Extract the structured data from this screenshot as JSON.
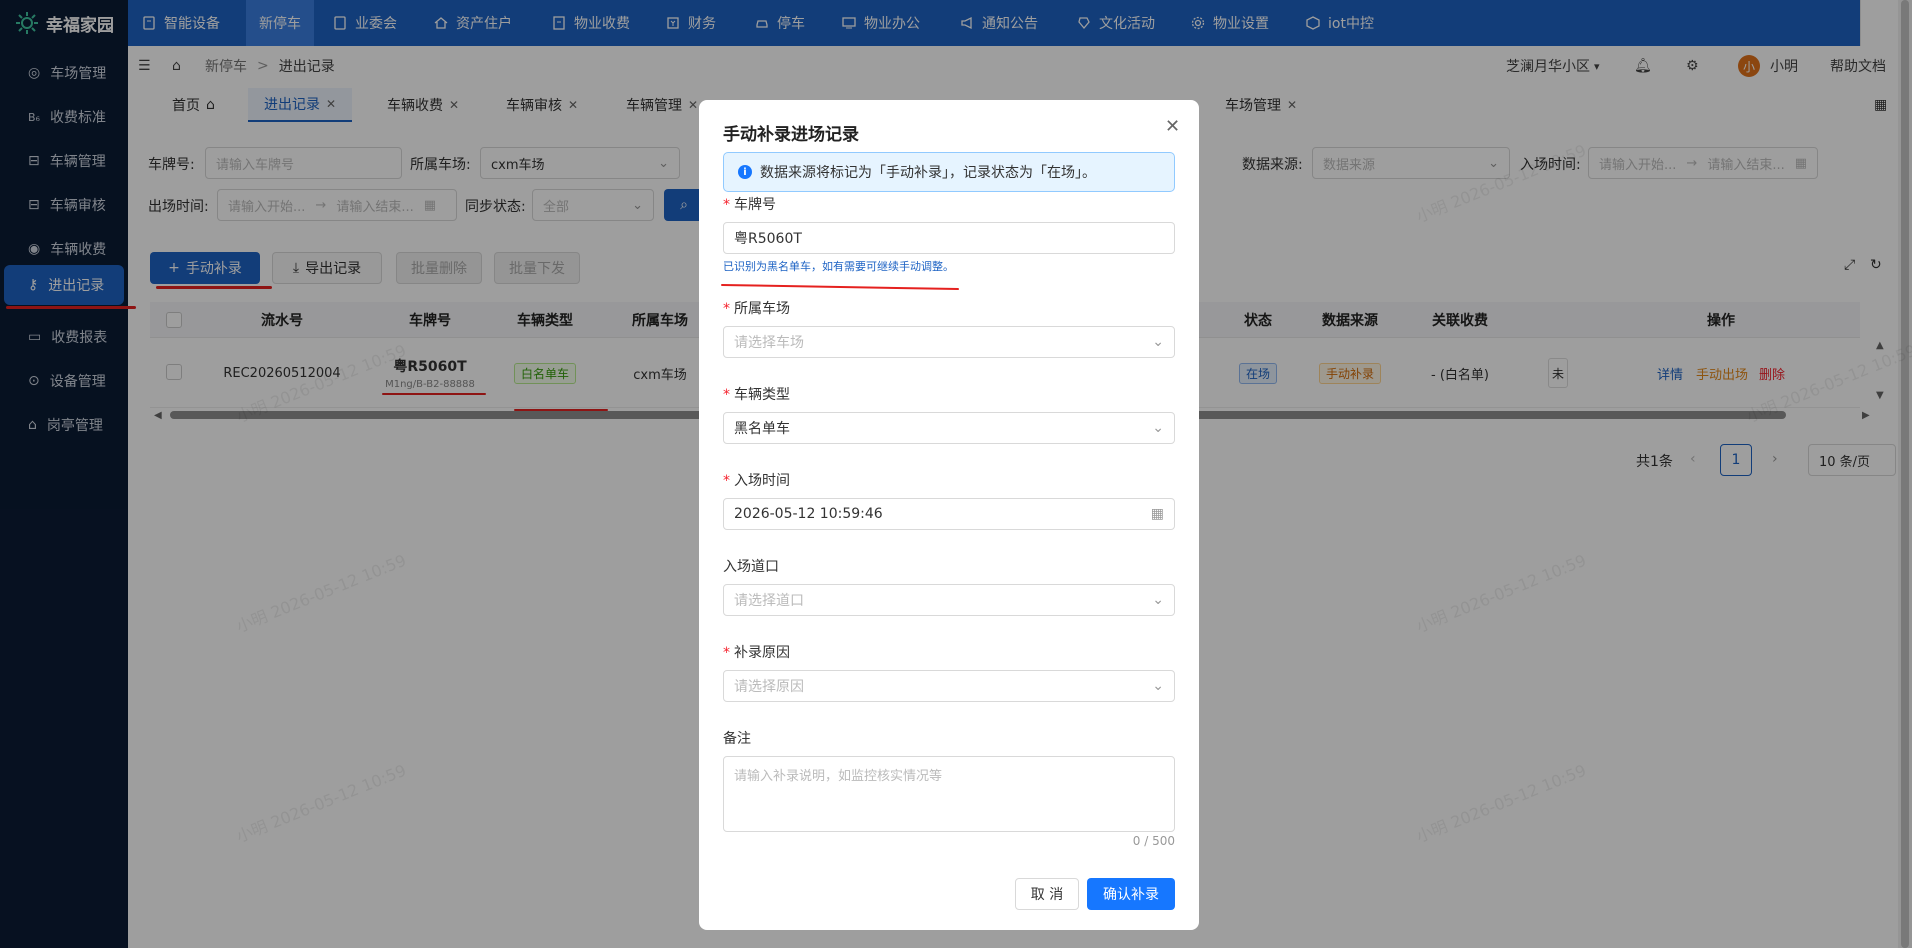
{
  "app": {
    "logo_text": "幸福家园"
  },
  "topnav": [
    {
      "label": "智能设备",
      "icon": "tablet-icon"
    },
    {
      "label": "新停车",
      "icon": ""
    },
    {
      "label": "业委会",
      "icon": "document-icon"
    },
    {
      "label": "资产住户",
      "icon": "home-icon"
    },
    {
      "label": "物业收费",
      "icon": "receipt-icon"
    },
    {
      "label": "财务",
      "icon": "finance-icon"
    },
    {
      "label": "停车",
      "icon": "car-icon"
    },
    {
      "label": "物业办公",
      "icon": "monitor-icon"
    },
    {
      "label": "通知公告",
      "icon": "megaphone-icon"
    },
    {
      "label": "文化活动",
      "icon": "activity-icon"
    },
    {
      "label": "物业设置",
      "icon": "gear-icon"
    },
    {
      "label": "iot中控",
      "icon": "cube-icon"
    }
  ],
  "sidebar": {
    "items": [
      {
        "label": "车场管理"
      },
      {
        "label": "收费标准"
      },
      {
        "label": "车辆管理"
      },
      {
        "label": "车辆审核"
      },
      {
        "label": "车辆收费"
      },
      {
        "label": "进出记录"
      },
      {
        "label": "收费报表"
      },
      {
        "label": "设备管理"
      },
      {
        "label": "岗亭管理"
      }
    ]
  },
  "breadcrumb": {
    "parent": "新停车",
    "sep": ">",
    "current": "进出记录"
  },
  "header_right": {
    "community": "芝澜月华小区",
    "avatar_initial": "小",
    "username": "小明",
    "help": "帮助文档"
  },
  "tabs": [
    {
      "label": "首页"
    },
    {
      "label": "进出记录"
    },
    {
      "label": "车辆收费"
    },
    {
      "label": "车辆审核"
    },
    {
      "label": "车辆管理"
    },
    {
      "label": "车场管理"
    }
  ],
  "filters": {
    "plate_label": "车牌号:",
    "plate_placeholder": "请输入车牌号",
    "lot_label": "所属车场:",
    "lot_value": "cxm车场",
    "source_label": "数据来源:",
    "source_placeholder": "数据来源",
    "entry_label": "入场时间:",
    "entry_start": "请输入开始...",
    "entry_end": "请输入结束...",
    "exit_label": "出场时间:",
    "exit_start": "请输入开始...",
    "exit_end": "请输入结束...",
    "sync_label": "同步状态:",
    "sync_value": "全部",
    "arrow": "→"
  },
  "actions": {
    "manual": "手动补录",
    "export": "导出记录",
    "batch_delete": "批量删除",
    "batch_issue": "批量下发"
  },
  "table": {
    "headers": {
      "serial": "流水号",
      "plate": "车牌号",
      "type": "车辆类型",
      "lot": "所属车场",
      "status": "状态",
      "source": "数据来源",
      "fee": "关联收费",
      "ops": "操作"
    },
    "row": {
      "serial": "REC20260512004",
      "plate": "粤R5060T",
      "plate_sub": "M1ng/B-B2-88888",
      "type": "白名单车",
      "lot": "cxm车场",
      "status": "在场",
      "source": "手动补录",
      "fee": "- (白名单)",
      "partial": "未",
      "op_detail": "详情",
      "op_exit": "手动出场",
      "op_delete": "删除"
    }
  },
  "pagination": {
    "total": "共1条",
    "page": "1",
    "size": "10 条/页"
  },
  "watermark": "小明 2026-05-12 10:59",
  "modal": {
    "title": "手动补录进场记录",
    "alert": "数据来源将标记为「手动补录」，记录状态为「在场」。",
    "plate_label": "车牌号",
    "plate_value": "粤R5060T",
    "plate_hint": "已识别为黑名单车，如有需要可继续手动调整。",
    "lot_label": "所属车场",
    "lot_placeholder": "请选择车场",
    "type_label": "车辆类型",
    "type_value": "黑名单车",
    "time_label": "入场时间",
    "time_value": "2026-05-12 10:59:46",
    "gate_label": "入场道口",
    "gate_placeholder": "请选择道口",
    "reason_label": "补录原因",
    "reason_placeholder": "请选择原因",
    "note_label": "备注",
    "note_placeholder": "请输入补录说明，如监控核实情况等",
    "note_count": "0 / 500",
    "cancel": "取 消",
    "confirm": "确认补录"
  },
  "colors": {
    "primary": "#1e63c4",
    "sidebar": "#0b1c35",
    "annotation": "#e5211f"
  }
}
